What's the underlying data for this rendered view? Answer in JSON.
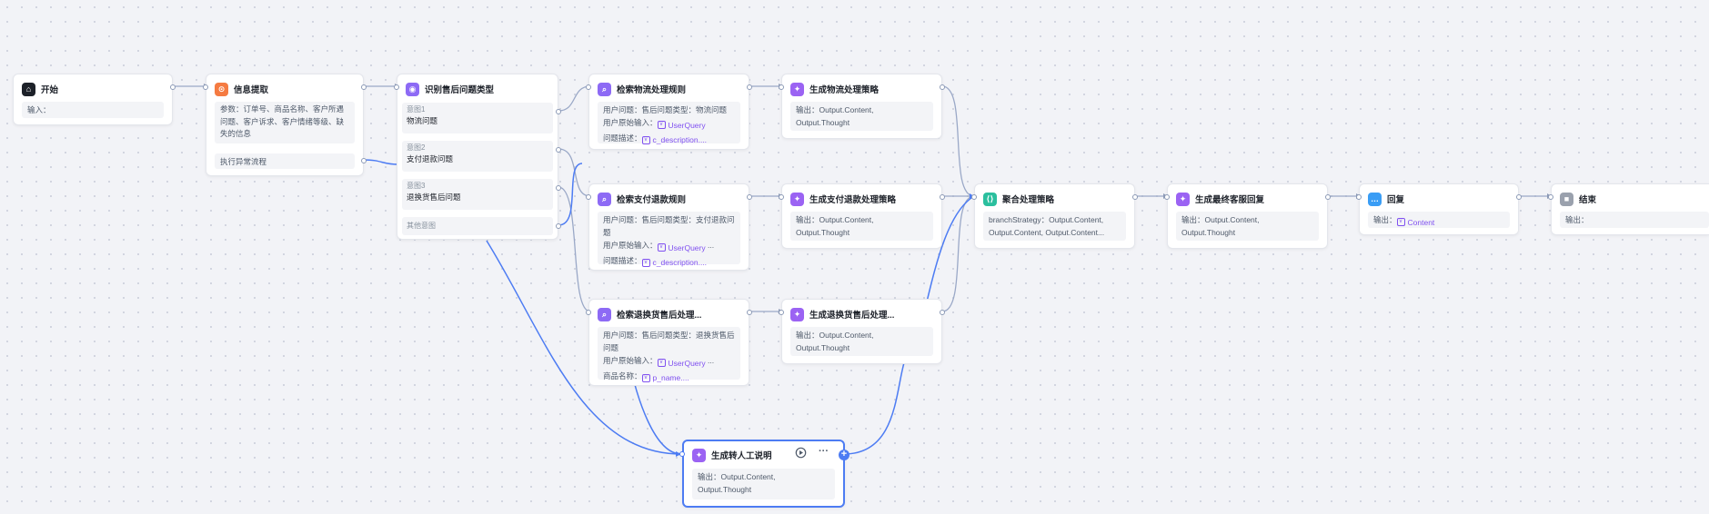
{
  "canvas": {
    "background": "#f2f3f7",
    "edge_color": "#9aa8c7",
    "active_edge_color": "#4d7cf3"
  },
  "nodes": {
    "start": {
      "title": "开始",
      "icon": "home-icon",
      "input_label": "输入："
    },
    "extract": {
      "title": "信息提取",
      "icon": "extract-icon",
      "params": "参数：订单号、商品名称、客户所遇问题、客户诉求、客户情绪等级、缺失的信息",
      "exception": "执行异常流程"
    },
    "classify": {
      "title": "识别售后问题类型",
      "icon": "classify-icon",
      "intents": [
        {
          "label": "意图1",
          "value": "物流问题"
        },
        {
          "label": "意图2",
          "value": "支付退款问题"
        },
        {
          "label": "意图3",
          "value": "退换货售后问题"
        }
      ],
      "other": "其他意图"
    },
    "search_logistics": {
      "title": "检索物流处理规则",
      "icon": "search-icon",
      "line1": "用户问题：售后问题类型：物流问题",
      "line2_label": "用户原始输入：",
      "line2_tag": "UserQuery",
      "line3_label": "问题描述：",
      "line3_tag": "c_description...."
    },
    "search_payment": {
      "title": "检索支付退款规则",
      "icon": "search-icon",
      "line1": "用户问题：售后问题类型：支付退款问题",
      "line2_label": "用户原始输入：",
      "line2_tag": "UserQuery",
      "line2_more": "...",
      "line3_label": "问题描述：",
      "line3_tag": "c_description...."
    },
    "search_return": {
      "title": "检索退换货售后处理...",
      "icon": "search-icon",
      "line1": "用户问题：售后问题类型：退换货售后问题",
      "line2_label": "用户原始输入：",
      "line2_tag": "UserQuery",
      "line2_more": "...",
      "line3_label": "商品名称：",
      "line3_tag": "p_name...."
    },
    "gen_logistics": {
      "title": "生成物流处理策略",
      "icon": "sparkle-icon",
      "output": "输出：Output.Content, Output.Thought"
    },
    "gen_payment": {
      "title": "生成支付退款处理策略",
      "icon": "sparkle-icon",
      "output": "输出：Output.Content, Output.Thought"
    },
    "gen_return": {
      "title": "生成退换货售后处理...",
      "icon": "sparkle-icon",
      "output": "输出：Output.Content, Output.Thought"
    },
    "aggregate": {
      "title": "聚合处理策略",
      "icon": "aggregate-icon",
      "content": "branchStrategy：Output.Content, Output.Content, Output.Content..."
    },
    "final": {
      "title": "生成最终客服回复",
      "icon": "sparkle-icon",
      "output": "输出：Output.Content, Output.Thought"
    },
    "reply": {
      "title": "回复",
      "icon": "chat-icon",
      "output_label": "输出：",
      "output_tag": "Content"
    },
    "end": {
      "title": "结束",
      "icon": "stop-icon",
      "output_label": "输出："
    },
    "handoff": {
      "title": "生成转人工说明",
      "icon": "sparkle-icon",
      "output": "输出：Output.Content, Output.Thought",
      "more": "···"
    }
  }
}
